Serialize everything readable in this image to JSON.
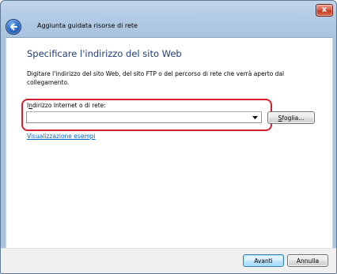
{
  "window": {
    "close_label": "x",
    "title": "Aggiunta guidata risorse di rete"
  },
  "page": {
    "heading": "Specificare l'indirizzo del sito Web",
    "description": "Digitare l'indirizzo del sito Web, del sito FTP o del percorso di rete che verrà aperto dal collegamento."
  },
  "address": {
    "label_mnemonic": "n",
    "label_prefix": "I",
    "label_rest": "dirizzo Internet o di rete:",
    "value": "",
    "placeholder": ""
  },
  "browse": {
    "label_mnemonic": "S",
    "label_rest": "foglia..."
  },
  "examples_link": "Visualizzazione esempi",
  "footer": {
    "next_label": "Avanti",
    "cancel_label": "Annulla"
  },
  "colors": {
    "highlight": "#d4202c",
    "heading": "#1f3d7a",
    "link": "#0066cc"
  },
  "icons": [
    "close-icon",
    "back-arrow-icon",
    "dropdown-arrow-icon"
  ]
}
